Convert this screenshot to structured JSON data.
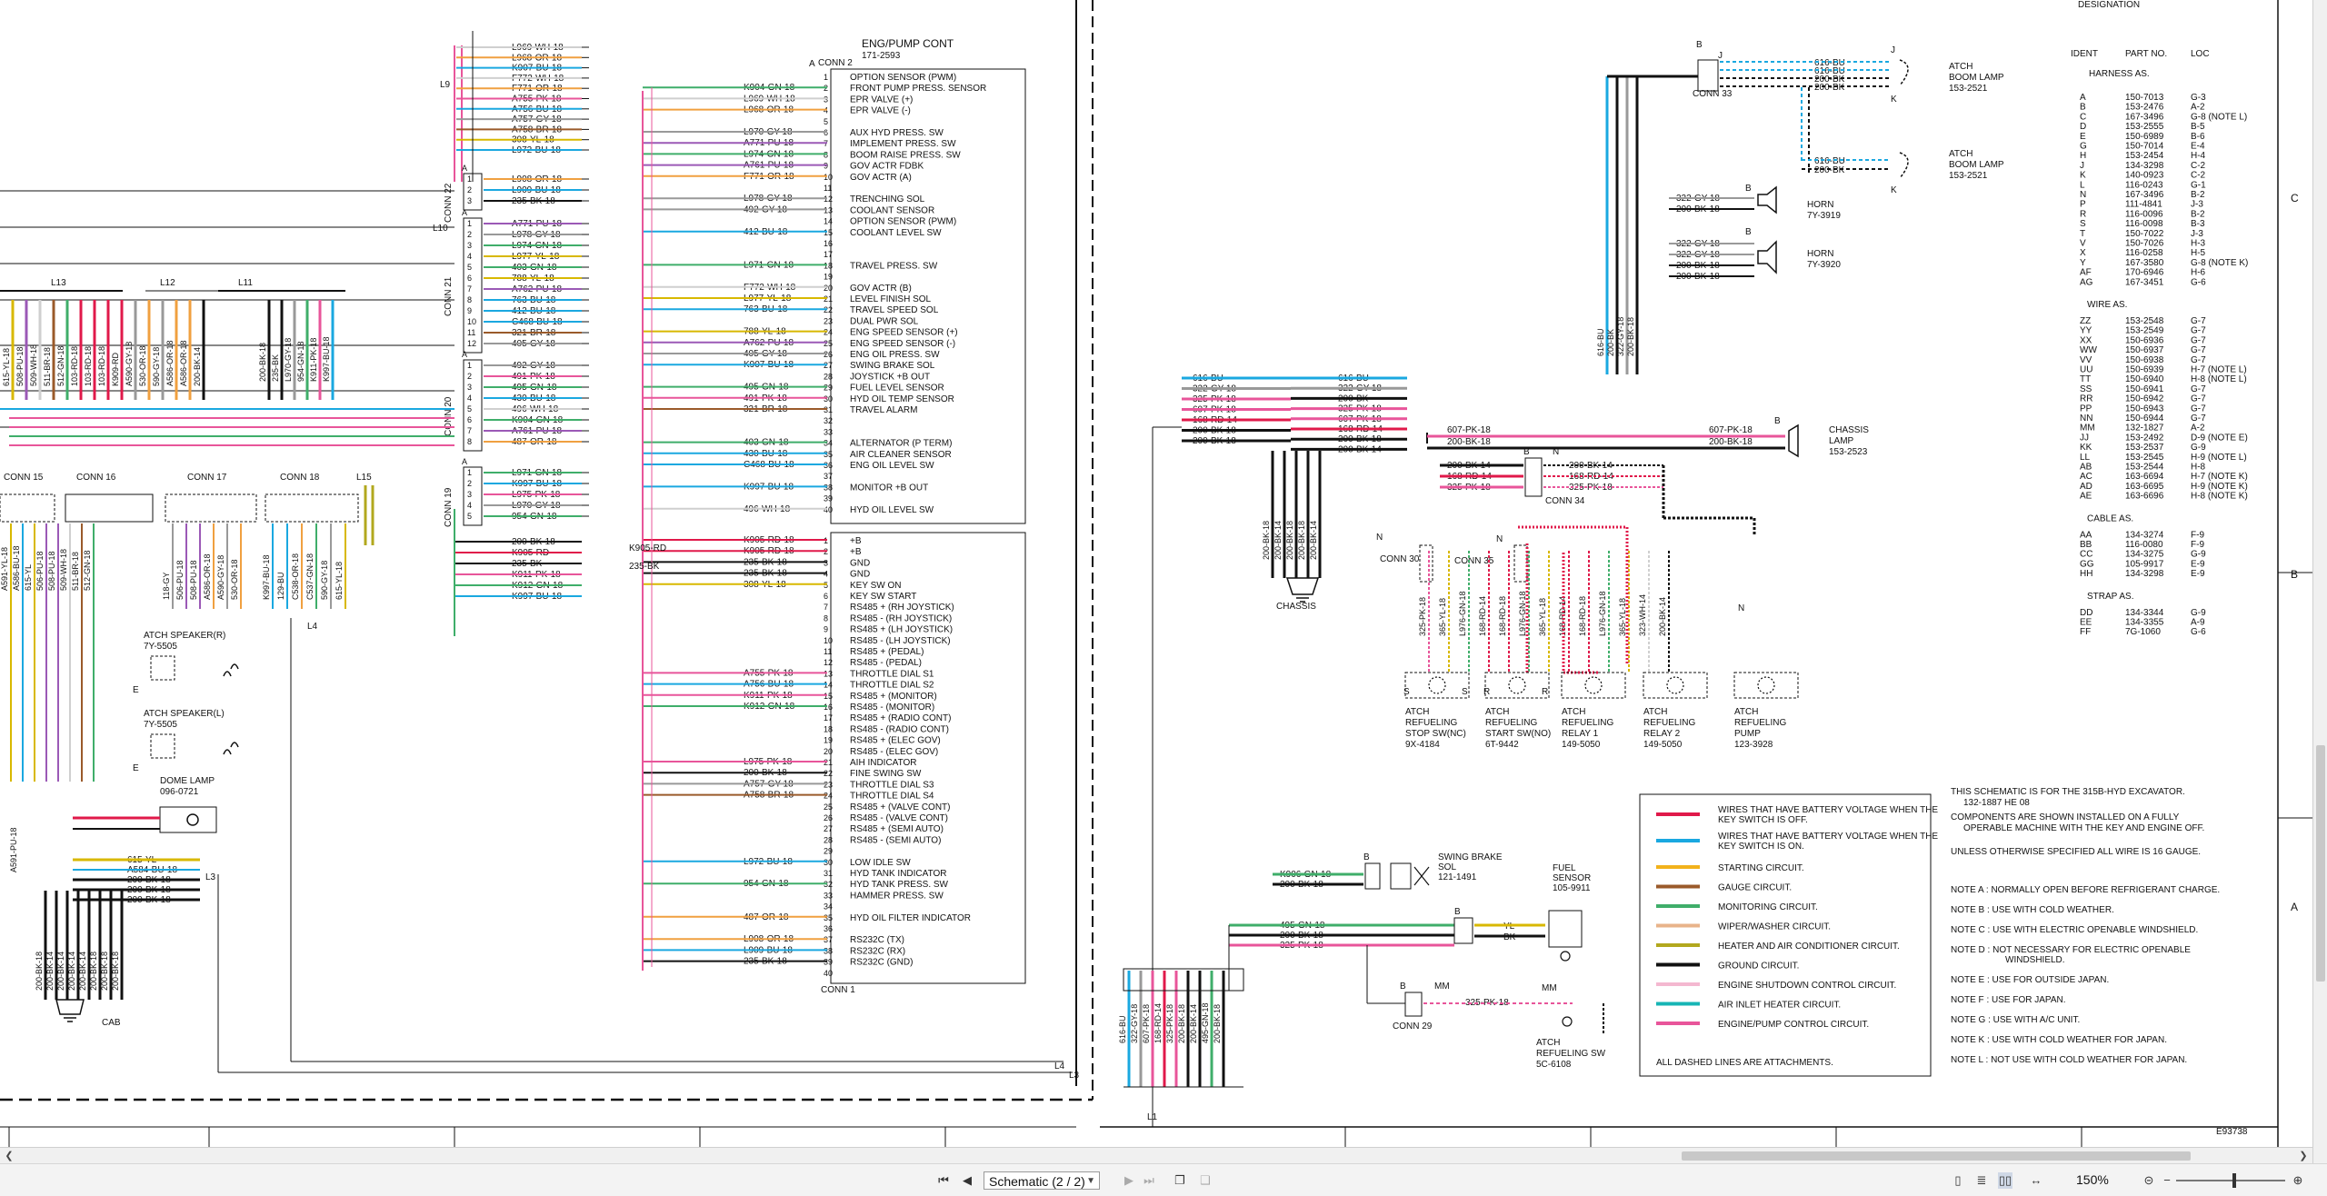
{
  "viewer": {
    "page_selector_value": "Schematic (2 / 2)",
    "zoom_level": "150%"
  },
  "diagram": {
    "eng_pump_title": "ENG/PUMP CONT",
    "eng_pump_part": "171-2593",
    "conn2_label": "CONN 2",
    "conn1_label": "CONN 1",
    "conn2_pins": [
      {
        "n": "1",
        "wire": "",
        "name": "OPTION SENSOR (PWM)"
      },
      {
        "n": "2",
        "wire": "K904-GN-18",
        "name": "FRONT PUMP PRESS. SENSOR"
      },
      {
        "n": "3",
        "wire": "L969-WH-18",
        "name": "EPR VALVE (+)"
      },
      {
        "n": "4",
        "wire": "L968-OR-18",
        "name": "EPR VALVE (-)"
      },
      {
        "n": "5",
        "wire": "",
        "name": ""
      },
      {
        "n": "6",
        "wire": "L970-GY-18",
        "name": "AUX HYD PRESS. SW"
      },
      {
        "n": "7",
        "wire": "A771-PU-18",
        "name": "IMPLEMENT PRESS. SW"
      },
      {
        "n": "8",
        "wire": "L974-GN-18",
        "name": "BOOM RAISE PRESS. SW"
      },
      {
        "n": "9",
        "wire": "A761-PU-18",
        "name": "GOV ACTR FDBK"
      },
      {
        "n": "10",
        "wire": "F771-OR-18",
        "name": "GOV ACTR (A)"
      },
      {
        "n": "11",
        "wire": "",
        "name": ""
      },
      {
        "n": "12",
        "wire": "L978-GY-18",
        "name": "TRENCHING SOL"
      },
      {
        "n": "13",
        "wire": "492-GY-18",
        "name": "COOLANT SENSOR"
      },
      {
        "n": "14",
        "wire": "",
        "name": "OPTION SENSOR (PWM)"
      },
      {
        "n": "15",
        "wire": "412-BU-18",
        "name": "COOLANT LEVEL SW"
      },
      {
        "n": "16",
        "wire": "",
        "name": ""
      },
      {
        "n": "17",
        "wire": "",
        "name": ""
      },
      {
        "n": "18",
        "wire": "L971-GN-18",
        "name": "TRAVEL PRESS. SW"
      },
      {
        "n": "19",
        "wire": "",
        "name": ""
      },
      {
        "n": "20",
        "wire": "F772-WH-18",
        "name": "GOV ACTR (B)"
      },
      {
        "n": "21",
        "wire": "L977-YL-18",
        "name": "LEVEL FINISH SOL"
      },
      {
        "n": "22",
        "wire": "763-BU-18",
        "name": "TRAVEL SPEED SOL"
      },
      {
        "n": "23",
        "wire": "",
        "name": "DUAL PWR SOL"
      },
      {
        "n": "24",
        "wire": "788-YL-18",
        "name": "ENG SPEED SENSOR (+)"
      },
      {
        "n": "25",
        "wire": "A762-PU-18",
        "name": "ENG SPEED SENSOR (-)"
      },
      {
        "n": "26",
        "wire": "405-GY-18",
        "name": "ENG OIL PRESS. SW"
      },
      {
        "n": "27",
        "wire": "K907-BU-18",
        "name": "SWING BRAKE SOL"
      },
      {
        "n": "28",
        "wire": "",
        "name": "JOYSTICK +B OUT"
      },
      {
        "n": "29",
        "wire": "495-GN-18",
        "name": "FUEL LEVEL SENSOR"
      },
      {
        "n": "30",
        "wire": "491-PK-18",
        "name": "HYD OIL TEMP SENSOR"
      },
      {
        "n": "31",
        "wire": "321-BR-18",
        "name": "TRAVEL ALARM"
      },
      {
        "n": "32",
        "wire": "",
        "name": ""
      },
      {
        "n": "33",
        "wire": "",
        "name": ""
      },
      {
        "n": "34",
        "wire": "403-GN-18",
        "name": "ALTERNATOR (P TERM)"
      },
      {
        "n": "35",
        "wire": "430-BU-18",
        "name": "AIR CLEANER SENSOR"
      },
      {
        "n": "36",
        "wire": "C468-BU-18",
        "name": "ENG OIL LEVEL SW"
      },
      {
        "n": "37",
        "wire": "",
        "name": ""
      },
      {
        "n": "38",
        "wire": "K997-BU-18",
        "name": "MONITOR +B OUT"
      },
      {
        "n": "39",
        "wire": "",
        "name": ""
      },
      {
        "n": "40",
        "wire": "496-WH-18",
        "name": "HYD OIL LEVEL SW"
      }
    ],
    "conn1_pins": [
      {
        "n": "1",
        "wire": "K905-RD-18",
        "name": "+B"
      },
      {
        "n": "2",
        "wire": "K905-RD-18",
        "name": "+B"
      },
      {
        "n": "3",
        "wire": "235-BK-18",
        "name": "GND"
      },
      {
        "n": "4",
        "wire": "235-BK-18",
        "name": "GND"
      },
      {
        "n": "5",
        "wire": "308-YL-18",
        "name": "KEY SW ON"
      },
      {
        "n": "6",
        "wire": "",
        "name": "KEY SW START"
      },
      {
        "n": "7",
        "wire": "",
        "name": "RS485 + (RH JOYSTICK)"
      },
      {
        "n": "8",
        "wire": "",
        "name": "RS485 - (RH JOYSTICK)"
      },
      {
        "n": "9",
        "wire": "",
        "name": "RS485 + (LH JOYSTICK)"
      },
      {
        "n": "10",
        "wire": "",
        "name": "RS485 - (LH JOYSTICK)"
      },
      {
        "n": "11",
        "wire": "",
        "name": "RS485 + (PEDAL)"
      },
      {
        "n": "12",
        "wire": "",
        "name": "RS485 - (PEDAL)"
      },
      {
        "n": "13",
        "wire": "A755-PK-18",
        "name": "THROTTLE DIAL S1"
      },
      {
        "n": "14",
        "wire": "A756-BU-18",
        "name": "THROTTLE DIAL S2"
      },
      {
        "n": "15",
        "wire": "K911-PK-18",
        "name": "RS485 + (MONITOR)"
      },
      {
        "n": "16",
        "wire": "K912-GN-18",
        "name": "RS485 - (MONITOR)"
      },
      {
        "n": "17",
        "wire": "",
        "name": "RS485 + (RADIO CONT)"
      },
      {
        "n": "18",
        "wire": "",
        "name": "RS485 - (RADIO CONT)"
      },
      {
        "n": "19",
        "wire": "",
        "name": "RS485 + (ELEC GOV)"
      },
      {
        "n": "20",
        "wire": "",
        "name": "RS485 - (ELEC GOV)"
      },
      {
        "n": "21",
        "wire": "L975-PK-18",
        "name": "AIH INDICATOR"
      },
      {
        "n": "22",
        "wire": "200-BK-18",
        "name": "FINE SWING SW"
      },
      {
        "n": "23",
        "wire": "A757-GY-18",
        "name": "THROTTLE DIAL S3"
      },
      {
        "n": "24",
        "wire": "A758-BR-18",
        "name": "THROTTLE DIAL S4"
      },
      {
        "n": "25",
        "wire": "",
        "name": "RS485 + (VALVE CONT)"
      },
      {
        "n": "26",
        "wire": "",
        "name": "RS485 - (VALVE CONT)"
      },
      {
        "n": "27",
        "wire": "",
        "name": "RS485 + (SEMI AUTO)"
      },
      {
        "n": "28",
        "wire": "",
        "name": "RS485 - (SEMI AUTO)"
      },
      {
        "n": "29",
        "wire": "",
        "name": ""
      },
      {
        "n": "30",
        "wire": "L972-BU-18",
        "name": "LOW IDLE SW"
      },
      {
        "n": "31",
        "wire": "",
        "name": "HYD TANK INDICATOR"
      },
      {
        "n": "32",
        "wire": "954-GN-18",
        "name": "HYD TANK PRESS. SW"
      },
      {
        "n": "33",
        "wire": "",
        "name": "HAMMER PRESS. SW"
      },
      {
        "n": "34",
        "wire": "",
        "name": ""
      },
      {
        "n": "35",
        "wire": "487-OR-18",
        "name": "HYD OIL FILTER INDICATOR"
      },
      {
        "n": "36",
        "wire": "",
        "name": ""
      },
      {
        "n": "37",
        "wire": "L908-OR-18",
        "name": "RS232C (TX)"
      },
      {
        "n": "38",
        "wire": "L909-BU-18",
        "name": "RS232C (RX)"
      },
      {
        "n": "39",
        "wire": "235-BK-18",
        "name": "RS232C (GND)"
      },
      {
        "n": "40",
        "wire": "",
        "name": ""
      }
    ],
    "top_bundle_wires": [
      "L969-WH-18",
      "L968-OR-18",
      "K907-BU-18",
      "F772-WH-18",
      "F771-OR-18",
      "A755-PK-18",
      "A756-BU-18",
      "A757-GY-18",
      "A758-BR-18",
      "308-YL-18",
      "L972-BU-18"
    ],
    "conn22_wires": [
      "L908-OR-18",
      "L909-BU-18",
      "235-BK-18"
    ],
    "conn21_wires": [
      "A771-PU-18",
      "L978-GY-18",
      "L974-GN-18",
      "L977-YL-18",
      "403-GN-18",
      "788-YL-18",
      "A762-PU-18",
      "763-BU-18",
      "412-BU-18",
      "C468-BU-18",
      "321-BR-18",
      "405-GY-18"
    ],
    "conn20_wires": [
      "492-GY-18",
      "491-PK-18",
      "495-GN-18",
      "430-BU-18",
      "496-WH-18",
      "K904-GN-18",
      "A761-PU-18",
      "487-OR-18"
    ],
    "conn19_wires": [
      "L971-GN-18",
      "K997-BU-18",
      "L975-PK-18",
      "L970-GY-18",
      "954-GN-18"
    ],
    "bottom_bundle_wires": [
      "200-BK-18",
      "K905-RD",
      "235-BK",
      "K911-PK-18",
      "K912-GN-18",
      "K997-BU-18"
    ],
    "conn_labels": {
      "c22": "CONN 22",
      "c21": "CONN 21",
      "c20": "CONN 20",
      "c19": "CONN 19",
      "c15": "CONN 15",
      "c16": "CONN 16",
      "c17": "CONN 17",
      "c18": "CONN 18",
      "c33": "CONN 33",
      "c34": "CONN 34",
      "c30": "CONN 30",
      "c35": "CONN 35",
      "c29": "CONN 29"
    },
    "line_labels": {
      "l9": "L9",
      "l10": "L10",
      "l11": "L11",
      "l12": "L12",
      "l13": "L13",
      "l15": "L15",
      "l4": "L4",
      "l3": "L3",
      "l1": "L1"
    },
    "pin_letters": {
      "a": "A",
      "b": "B",
      "c": "C",
      "j": "J",
      "k": "K",
      "n": "N",
      "r": "R",
      "s": "S",
      "mm": "MM"
    },
    "left_vertical_wires": [
      "615-YL-18",
      "508-PU-18",
      "509-WH-18",
      "511-BR-18",
      "512-GN-18",
      "103-RD-18",
      "103-RD-18",
      "103-RD-18",
      "K909-RD",
      "A590-GY-18",
      "530-OR-18",
      "590-GY-18",
      "A586-OR-18",
      "A586-OR-18",
      "200-BK-14"
    ],
    "l11_wires": [
      "200-BK-18",
      "235-BK",
      "L970-GY-18",
      "954-GN-18",
      "K911-PK-18",
      "K997-BU-18"
    ],
    "lower_left_wires": [
      "A591-YL-18",
      "A586-BU-18",
      "615-YL",
      "506-PU-18",
      "508-PU-18",
      "509-WH-18",
      "511-BR-18",
      "512-GN-18"
    ],
    "conn17_wires": [
      "118-GY",
      "506-PU-18",
      "508-PU-18",
      "A586-OR-18",
      "A590-GY-18",
      "530-OR-18"
    ],
    "conn18_wires": [
      "K997-BU-18",
      "129-BU",
      "C538-OR-18",
      "C537-GN-18",
      "590-GY-18",
      "615-YL-18"
    ],
    "speaker_r": "ATCH SPEAKER(R)",
    "speaker_r_part": "7Y-5505",
    "speaker_l": "ATCH SPEAKER(L)",
    "speaker_l_part": "7Y-5505",
    "dome_lamp": "DOME LAMP",
    "dome_lamp_part": "096-0721",
    "a591_wire": "A591-PU-18",
    "cab_wires": [
      "615-YL",
      "A584-BU-18",
      "200-BK-18",
      "200-BK-18",
      "200-BK-18"
    ],
    "cab_bundle": [
      "200-BK-18",
      "200-BK-14",
      "200-BK-14",
      "200-BK-14",
      "200-BK-14",
      "200-BK-18",
      "200-BK-18",
      "200-BK-18"
    ],
    "cab_label": "CAB",
    "chassis_label": "CHASSIS",
    "boom_lamp": "ATCH",
    "boom_lamp_sub": "BOOM LAMP",
    "boom_lamp_part": "153-2521",
    "boom_wires": [
      "616-BU",
      "616-BU",
      "200-BK",
      "200-BK"
    ],
    "boom2_wires": [
      "616-BU",
      "200-BK"
    ],
    "horn1": "HORN",
    "horn1_part": "7Y-3919",
    "horn2": "HORN",
    "horn2_part": "7Y-3920",
    "horn_wires": [
      "322-GY-18",
      "200-BK-18",
      "322-GY-18",
      "322-GY-18",
      "200-BK-18",
      "200-BK-18"
    ],
    "horn_vertical": [
      "616-BU",
      "200-BK",
      "322-GY-18",
      "200-BK-18"
    ],
    "chassis_bus_left": [
      "616-BU",
      "322-GY-18",
      "325-PK-18",
      "607-PK-18",
      "168-RD-14",
      "200-BK-18",
      "200-BK-18"
    ],
    "chassis_bus_right": [
      "616-BU",
      "322-GY-18",
      "200-BK",
      "325-PK-18",
      "607-PK-18",
      "168-RD-14",
      "200-BK-18",
      "200-BK-14"
    ],
    "chassis_vertical": [
      "200-BK-18",
      "200-BK-14",
      "200-BK-18",
      "200-BK-18",
      "200-BK-14"
    ],
    "chassis_lamp": "CHASSIS",
    "chassis_lamp_sub": "LAMP",
    "chassis_lamp_part": "153-2523",
    "chassis_lamp_wires": [
      "607-PK-18",
      "200-BK-18",
      "607-PK-18",
      "200-BK-18"
    ],
    "conn34_wires": [
      "200-BK-14",
      "168-RD-14",
      "325-PK-18",
      "200-BK-14",
      "168-RD-14",
      "325-PK-18"
    ],
    "refuel_stop": [
      "ATCH",
      "REFUELING",
      "STOP SW(NC)",
      "9X-4184"
    ],
    "refuel_start": [
      "ATCH",
      "REFUELING",
      "START SW(NO)",
      "6T-9442"
    ],
    "refuel_relay1": [
      "ATCH",
      "REFUELING",
      "RELAY 1",
      "149-5050"
    ],
    "refuel_relay2": [
      "ATCH",
      "REFUELING",
      "RELAY 2",
      "149-5050"
    ],
    "refuel_pump": [
      "ATCH",
      "REFUELING",
      "PUMP",
      "123-3928"
    ],
    "refuel_vert_wires": [
      "325-PK-18",
      "365-YL-18",
      "L976-GN-18",
      "168-RD-14",
      "168-RD-18",
      "L976-GN-18",
      "365-YL-18",
      "168-RD-14",
      "168-RD-18",
      "L976-GN-18",
      "365-YL-18",
      "323-WH-14",
      "200-BK-14"
    ],
    "swing_brake": [
      "SWING BRAKE",
      "SOL",
      "121-1491"
    ],
    "swing_wires": [
      "K906-GN-18",
      "200-BK-18"
    ],
    "fuel_sensor": [
      "FUEL",
      "SENSOR",
      "105-9911"
    ],
    "fuel_wires": [
      "495-GN-18",
      "200-BK-18",
      "325-PK-18",
      "YL",
      "BK"
    ],
    "refuel_sw": [
      "ATCH",
      "REFUELING SW",
      "5C-6108"
    ],
    "conn29_wire": "325-PK-18",
    "bottom_vertical": [
      "616-BU",
      "322-GY-18",
      "607-PK-18",
      "168-RD-14",
      "325-PK-18",
      "200-BK-18",
      "200-BK-14",
      "495-GN-18",
      "200-BK-18"
    ],
    "designation_title": "DESIGNATION",
    "table_headers": [
      "IDENT",
      "PART NO.",
      "LOC"
    ],
    "harness_title": "HARNESS AS.",
    "harness": [
      [
        "A",
        "150-7013",
        "G-3"
      ],
      [
        "B",
        "153-2476",
        "A-2"
      ],
      [
        "C",
        "167-3496",
        "G-8 (NOTE L)"
      ],
      [
        "D",
        "153-2555",
        "B-5"
      ],
      [
        "E",
        "150-6989",
        "B-6"
      ],
      [
        "G",
        "150-7014",
        "E-4"
      ],
      [
        "H",
        "153-2454",
        "H-4"
      ],
      [
        "J",
        "134-3298",
        "C-2"
      ],
      [
        "K",
        "140-0923",
        "C-2"
      ],
      [
        "L",
        "116-0243",
        "G-1"
      ],
      [
        "N",
        "167-3496",
        "B-2"
      ],
      [
        "P",
        "111-4841",
        "J-3"
      ],
      [
        "R",
        "116-0096",
        "B-2"
      ],
      [
        "S",
        "116-0098",
        "B-3"
      ],
      [
        "T",
        "150-7022",
        "J-3"
      ],
      [
        "V",
        "150-7026",
        "H-3"
      ],
      [
        "X",
        "116-0258",
        "H-5"
      ],
      [
        "Y",
        "167-3580",
        "G-8 (NOTE K)"
      ],
      [
        "AF",
        "170-6946",
        "H-6"
      ],
      [
        "AG",
        "167-3451",
        "G-6"
      ]
    ],
    "wire_title": "WIRE AS.",
    "wires": [
      [
        "ZZ",
        "153-2548",
        "G-7"
      ],
      [
        "YY",
        "153-2549",
        "G-7"
      ],
      [
        "XX",
        "150-6936",
        "G-7"
      ],
      [
        "WW",
        "150-6937",
        "G-7"
      ],
      [
        "VV",
        "150-6938",
        "G-7"
      ],
      [
        "UU",
        "150-6939",
        "H-7 (NOTE L)"
      ],
      [
        "TT",
        "150-6940",
        "H-8 (NOTE L)"
      ],
      [
        "SS",
        "150-6941",
        "G-7"
      ],
      [
        "RR",
        "150-6942",
        "G-7"
      ],
      [
        "PP",
        "150-6943",
        "G-7"
      ],
      [
        "NN",
        "150-6944",
        "G-7"
      ],
      [
        "MM",
        "132-1827",
        "A-2"
      ],
      [
        "JJ",
        "153-2492",
        "D-9 (NOTE E)"
      ],
      [
        "KK",
        "153-2537",
        "G-9"
      ],
      [
        "LL",
        "153-2545",
        "H-9 (NOTE L)"
      ],
      [
        "AB",
        "153-2544",
        "H-8"
      ],
      [
        "AC",
        "163-6694",
        "H-7 (NOTE K)"
      ],
      [
        "AD",
        "163-6695",
        "H-9 (NOTE K)"
      ],
      [
        "AE",
        "163-6696",
        "H-8 (NOTE K)"
      ]
    ],
    "cable_title": "CABLE AS.",
    "cables": [
      [
        "AA",
        "134-3274",
        "F-9"
      ],
      [
        "BB",
        "116-0080",
        "F-9"
      ],
      [
        "CC",
        "134-3275",
        "G-9"
      ],
      [
        "GG",
        "105-9917",
        "E-9"
      ],
      [
        "HH",
        "134-3298",
        "E-9"
      ]
    ],
    "strap_title": "STRAP AS.",
    "straps": [
      [
        "DD",
        "134-3344",
        "G-9"
      ],
      [
        "EE",
        "134-3355",
        "A-9"
      ],
      [
        "FF",
        "7G-1060",
        "G-6"
      ]
    ],
    "zone_letters": [
      "C",
      "B",
      "A"
    ],
    "legend": [
      {
        "color": "#e0194a",
        "text": "WIRES THAT HAVE BATTERY VOLTAGE WHEN THE KEY SWITCH IS OFF."
      },
      {
        "color": "#1aa8e0",
        "text": "WIRES THAT HAVE BATTERY VOLTAGE WHEN THE KEY SWITCH IS ON."
      },
      {
        "color": "#f2b21b",
        "text": "STARTING CIRCUIT."
      },
      {
        "color": "#9a5a2a",
        "text": "GAUGE CIRCUIT."
      },
      {
        "color": "#3fae6a",
        "text": "MONITORING CIRCUIT."
      },
      {
        "color": "#e8b38a",
        "text": "WIPER/WASHER CIRCUIT."
      },
      {
        "color": "#b2a81e",
        "text": "HEATER AND AIR CONDITIONER CIRCUIT."
      },
      {
        "color": "#111111",
        "text": "GROUND CIRCUIT."
      },
      {
        "color": "#f4b8d0",
        "text": "ENGINE SHUTDOWN CONTROL CIRCUIT."
      },
      {
        "color": "#17b5b5",
        "text": "AIR INLET HEATER CIRCUIT."
      },
      {
        "color": "#e8559a",
        "text": "ENGINE/PUMP CONTROL CIRCUIT."
      }
    ],
    "legend_dashed": "ALL DASHED LINES ARE ATTACHMENTS.",
    "notes_intro": [
      "THIS SCHEMATIC IS FOR THE 315B-HYD EXCAVATOR.",
      "132-1887 HE 08",
      "COMPONENTS ARE SHOWN INSTALLED ON A FULLY",
      "OPERABLE MACHINE WITH THE KEY AND ENGINE OFF.",
      "UNLESS OTHERWISE SPECIFIED ALL WIRE IS 16 GAUGE."
    ],
    "notes": [
      "NOTE A : NORMALLY OPEN BEFORE REFRIGERANT CHARGE.",
      "NOTE B : USE WITH COLD WEATHER.",
      "NOTE C : USE WITH ELECTRIC OPENABLE WINDSHIELD.",
      "NOTE D : NOT NECESSARY FOR ELECTRIC OPENABLE",
      "WINDSHIELD.",
      "NOTE E : USE FOR OUTSIDE JAPAN.",
      "NOTE F : USE FOR JAPAN.",
      "NOTE G : USE WITH A/C UNIT.",
      "NOTE K : USE WITH COLD WEATHER FOR JAPAN.",
      "NOTE L : NOT USE WITH COLD WEATHER FOR JAPAN."
    ],
    "drawing_id": "E93738"
  }
}
